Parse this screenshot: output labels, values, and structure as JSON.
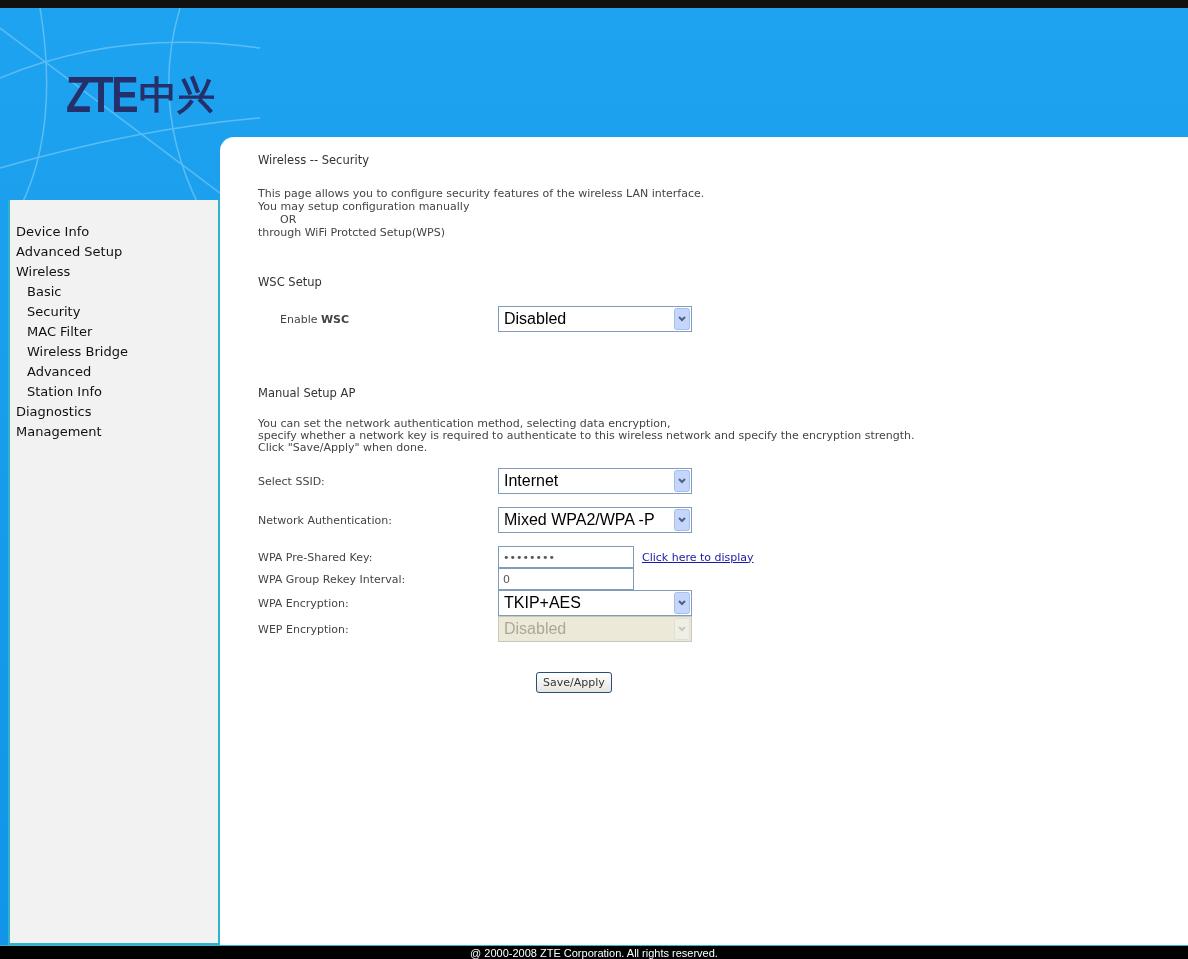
{
  "logo": {
    "latin": "ZTE",
    "cjk": "中兴"
  },
  "sidebar": {
    "items": [
      {
        "label": "Device Info"
      },
      {
        "label": "Advanced Setup"
      },
      {
        "label": "Wireless",
        "children": [
          {
            "label": "Basic"
          },
          {
            "label": "Security"
          },
          {
            "label": "MAC Filter"
          },
          {
            "label": "Wireless Bridge"
          },
          {
            "label": "Advanced"
          },
          {
            "label": "Station Info"
          }
        ]
      },
      {
        "label": "Diagnostics"
      },
      {
        "label": "Management"
      }
    ]
  },
  "page": {
    "title": "Wireless -- Security",
    "intro": [
      "This page allows you to configure security features of the wireless LAN interface.",
      "You may setup configuration manually",
      "OR",
      "through WiFi Protcted Setup(WPS)"
    ],
    "wsc": {
      "heading": "WSC Setup",
      "label": "Enable **WSC**",
      "value": "Disabled"
    },
    "manual": {
      "heading": "Manual Setup AP",
      "description": [
        "You can set the network authentication method, selecting data encryption,",
        "specify whether a network key is required to authenticate to this wireless network and specify the encryption strength.",
        "Click \"Save/Apply\" when done."
      ],
      "fields": [
        {
          "kind": "select",
          "label": "Select SSID:",
          "value": "Internet",
          "disabled": false
        },
        {
          "kind": "select",
          "label": "Network Authentication:",
          "value": "Mixed WPA2/WPA -P",
          "disabled": false
        },
        {
          "kind": "input",
          "label": "WPA Pre-Shared Key:",
          "value": "••••••••",
          "link": "Click here to display",
          "disabled": false
        },
        {
          "kind": "input",
          "label": "WPA Group Rekey Interval:",
          "value": "0",
          "disabled": false
        },
        {
          "kind": "select",
          "label": "WPA Encryption:",
          "value": "TKIP+AES",
          "disabled": false
        },
        {
          "kind": "select",
          "label": "WEP Encryption:",
          "value": "Disabled",
          "disabled": true
        }
      ]
    },
    "save_button": "Save/Apply"
  },
  "footer": "@ 2000-2008 ZTE Corporation. All rights reserved."
}
